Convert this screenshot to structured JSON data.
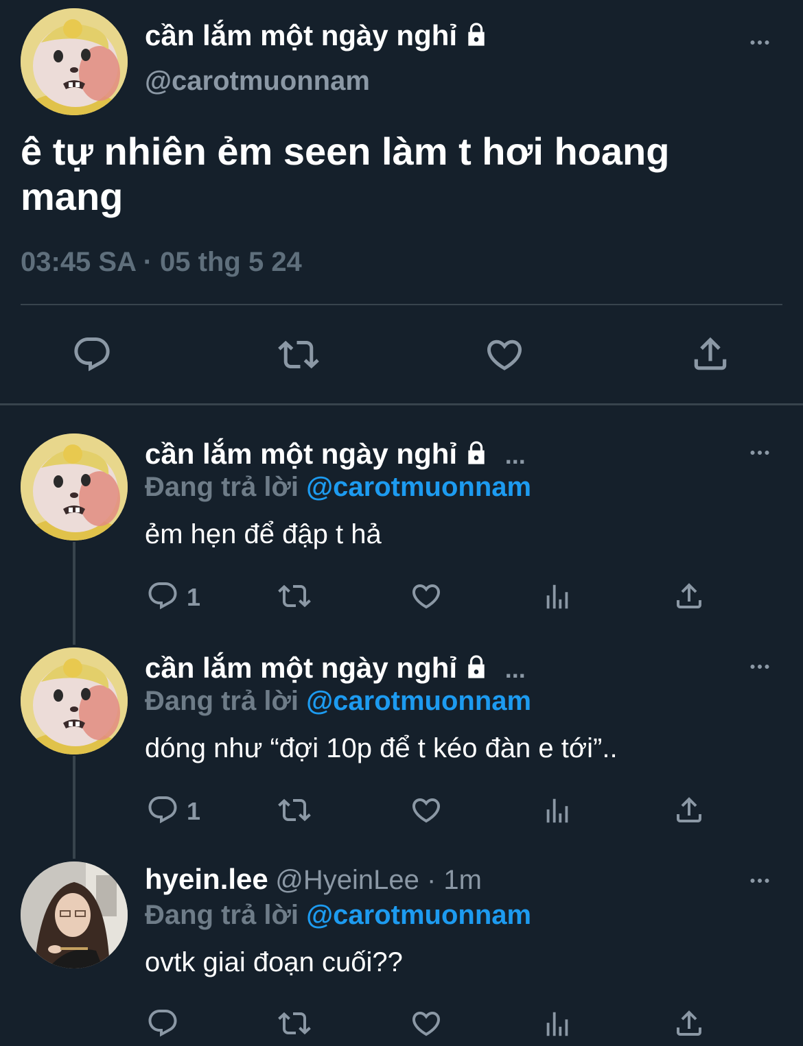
{
  "main_tweet": {
    "display_name": "cần lắm một ngày nghỉ",
    "handle": "@carotmuonnam",
    "text_line1": "ê tự nhiên ẻm seen làm t hơi hoang",
    "text_line2": "mang",
    "timestamp": "03:45 SA · 05 thg 5 24"
  },
  "replies": [
    {
      "display_name": "cần lắm một ngày nghỉ",
      "ellipsis": "...",
      "replying_prefix": "Đang trả lời",
      "replying_to": "@carotmuonnam",
      "text": "ẻm hẹn để đập t hả",
      "reply_count": "1"
    },
    {
      "display_name": "cần lắm một ngày nghỉ",
      "ellipsis": "...",
      "replying_prefix": "Đang trả lời",
      "replying_to": "@carotmuonnam",
      "text": "dóng như “đợi 10p để t kéo đàn e tới”..",
      "reply_count": "1"
    },
    {
      "display_name": "hyein.lee",
      "handle_meta": "@HyeinLee · 1m",
      "replying_prefix": "Đang trả lời",
      "replying_to": "@carotmuonnam",
      "text": "ovtk giai đoạn cuối??"
    }
  ],
  "colors": {
    "background": "#15202b",
    "text": "#ffffff",
    "secondary": "#8b98a5",
    "accent": "#1d9bf0",
    "divider": "#38444d"
  },
  "icons": [
    "more-icon",
    "lock-icon",
    "reply-icon",
    "retweet-icon",
    "like-icon",
    "share-icon",
    "views-icon"
  ]
}
